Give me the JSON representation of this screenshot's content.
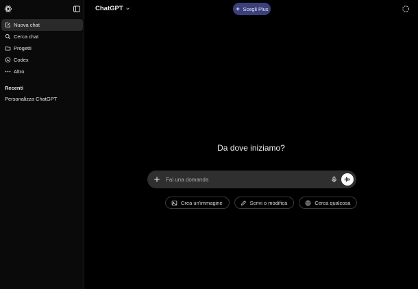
{
  "sidebar": {
    "items": [
      {
        "label": "Nuova chat",
        "icon": "new-chat-icon",
        "active": true
      },
      {
        "label": "Cerca chat",
        "icon": "search-icon",
        "active": false
      },
      {
        "label": "Progetti",
        "icon": "folder-icon",
        "active": false
      },
      {
        "label": "Codex",
        "icon": "codex-icon",
        "active": false
      },
      {
        "label": "Altro",
        "icon": "more-icon",
        "active": false
      }
    ],
    "section_title": "Recenti",
    "recents": [
      {
        "label": "Personalizza ChatGPT"
      }
    ]
  },
  "header": {
    "model_label": "ChatGPT",
    "upgrade_label": "Scegli Plus"
  },
  "main": {
    "greeting": "Da dove iniziamo?",
    "composer": {
      "placeholder": "Fai una domanda"
    },
    "suggestions": [
      {
        "label": "Crea un'immagine",
        "icon": "image-icon"
      },
      {
        "label": "Scrivi o modifica",
        "icon": "pen-icon"
      },
      {
        "label": "Cerca qualcosa",
        "icon": "globe-icon"
      }
    ]
  },
  "colors": {
    "background": "#000000",
    "sidebar_bg": "#0a0a0a",
    "active_item": "#2a2a2a",
    "composer_bg": "#2f2f2f",
    "upgrade_bg": "#3b3f7a",
    "text": "#ececec"
  }
}
